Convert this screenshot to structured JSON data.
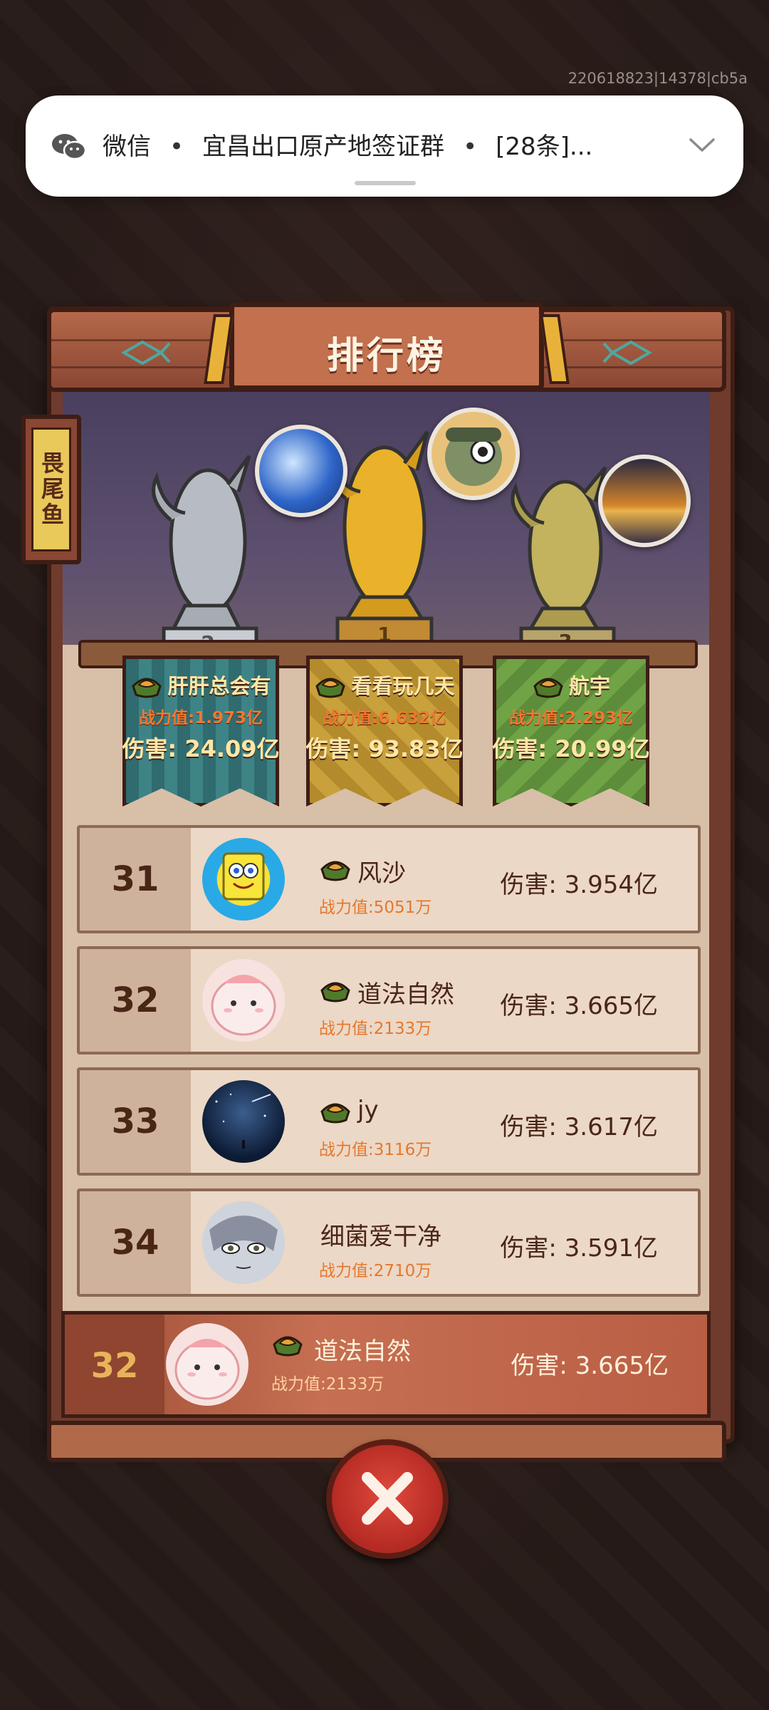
{
  "system": {
    "build_id": "220618823|14378|cb5a"
  },
  "notification": {
    "app": "微信",
    "group": "宜昌出口原产地签证群",
    "count": "[28条]..."
  },
  "board": {
    "title": "排行榜",
    "side_tab": "畏尾鱼"
  },
  "top3": [
    {
      "place": "1",
      "name": "看看玩几天",
      "power": "战力值:6.632亿",
      "damage": "伤害: 93.83亿"
    },
    {
      "place": "2",
      "name": "肝肝总会有",
      "power": "战力值:1.973亿",
      "damage": "伤害: 24.09亿"
    },
    {
      "place": "3",
      "name": "航宇",
      "power": "战力值:2.293亿",
      "damage": "伤害: 20.99亿"
    }
  ],
  "rows": [
    {
      "rank": "31",
      "name": "风沙",
      "power": "战力值:5051万",
      "damage": "伤害: 3.954亿",
      "avatar": "spongebob"
    },
    {
      "rank": "32",
      "name": "道法自然",
      "power": "战力值:2133万",
      "damage": "伤害: 3.665亿",
      "avatar": "pink-blob"
    },
    {
      "rank": "33",
      "name": "jy",
      "power": "战力值:3116万",
      "damage": "伤害: 3.617亿",
      "avatar": "night-sky"
    },
    {
      "rank": "34",
      "name": "细菌爱干净",
      "power": "战力值:2710万",
      "damage": "伤害: 3.591亿",
      "avatar": "anime-face"
    }
  ],
  "self": {
    "rank": "32",
    "name": "道法自然",
    "power": "战力值:2133万",
    "damage": "伤害: 3.665亿"
  },
  "colors": {
    "frame": "#3e1d15",
    "wood": "#b5684a",
    "power_text": "#e3782f",
    "self_rank": "#e7b45a",
    "close_button": "#c8352b"
  },
  "icons": {
    "notification_app": "wechat-icon",
    "expand": "chevron-down-icon",
    "rank_badge": "rank-badge-icon",
    "close": "close-icon"
  }
}
